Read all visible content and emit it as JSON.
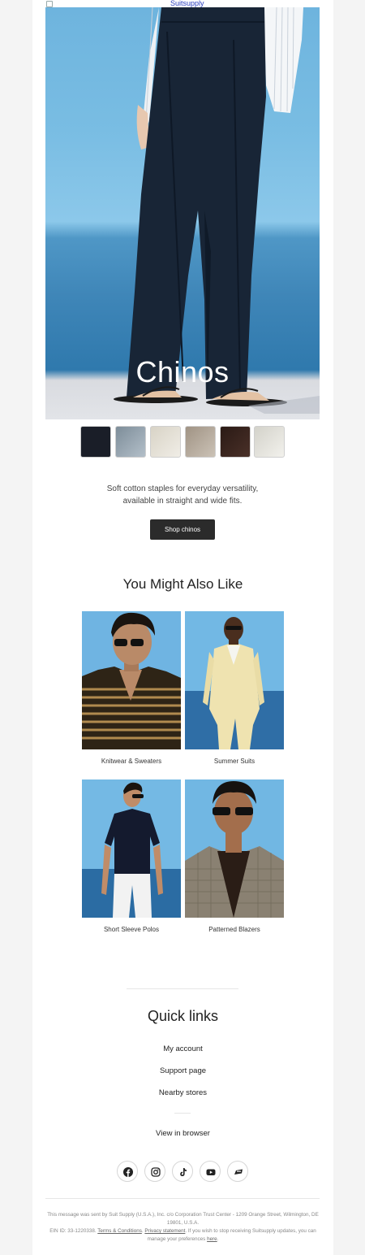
{
  "header": {
    "brand_link": "Suitsupply"
  },
  "hero": {
    "title": "Chinos"
  },
  "swatches": [
    {
      "name": "navy",
      "color": "#1a1e28"
    },
    {
      "name": "light-blue",
      "color": "#9aa8b4"
    },
    {
      "name": "ecru",
      "color": "#e6e2d8"
    },
    {
      "name": "taupe",
      "color": "#b8aea2"
    },
    {
      "name": "brown",
      "color": "#3a2620"
    },
    {
      "name": "off-white",
      "color": "#e4e3dc"
    }
  ],
  "intro": {
    "line1": "Soft cotton staples for everyday versatility,",
    "line2": "available in straight and wide fits.",
    "button": "Shop chinos"
  },
  "also_like": {
    "title": "You Might Also Like",
    "items": [
      {
        "label": "Knitwear & Sweaters"
      },
      {
        "label": "Summer Suits"
      },
      {
        "label": "Short Sleeve Polos"
      },
      {
        "label": "Patterned Blazers"
      }
    ]
  },
  "quick_links": {
    "title": "Quick links",
    "items": [
      "My account",
      "Support page",
      "Nearby stores"
    ],
    "browser": "View in browser"
  },
  "socials": [
    "facebook-icon",
    "instagram-icon",
    "tiktok-icon",
    "youtube-icon",
    "podcast-icon"
  ],
  "footer": {
    "text1": "This message was sent by Suit Supply (U.S.A.), Inc. c/o Corporation Trust Center - 1209 Orange Street, Wilmington, DE 19801, U.S.A.",
    "ein": "EIN ID: 33-1220338.",
    "terms": "Terms & Conditions",
    "sep": ".",
    "privacy": "Privacy statement",
    "text2": ". If you wish to stop receiving Suitsupply updates, you can manage your preferences",
    "here": "here",
    "end": "."
  }
}
